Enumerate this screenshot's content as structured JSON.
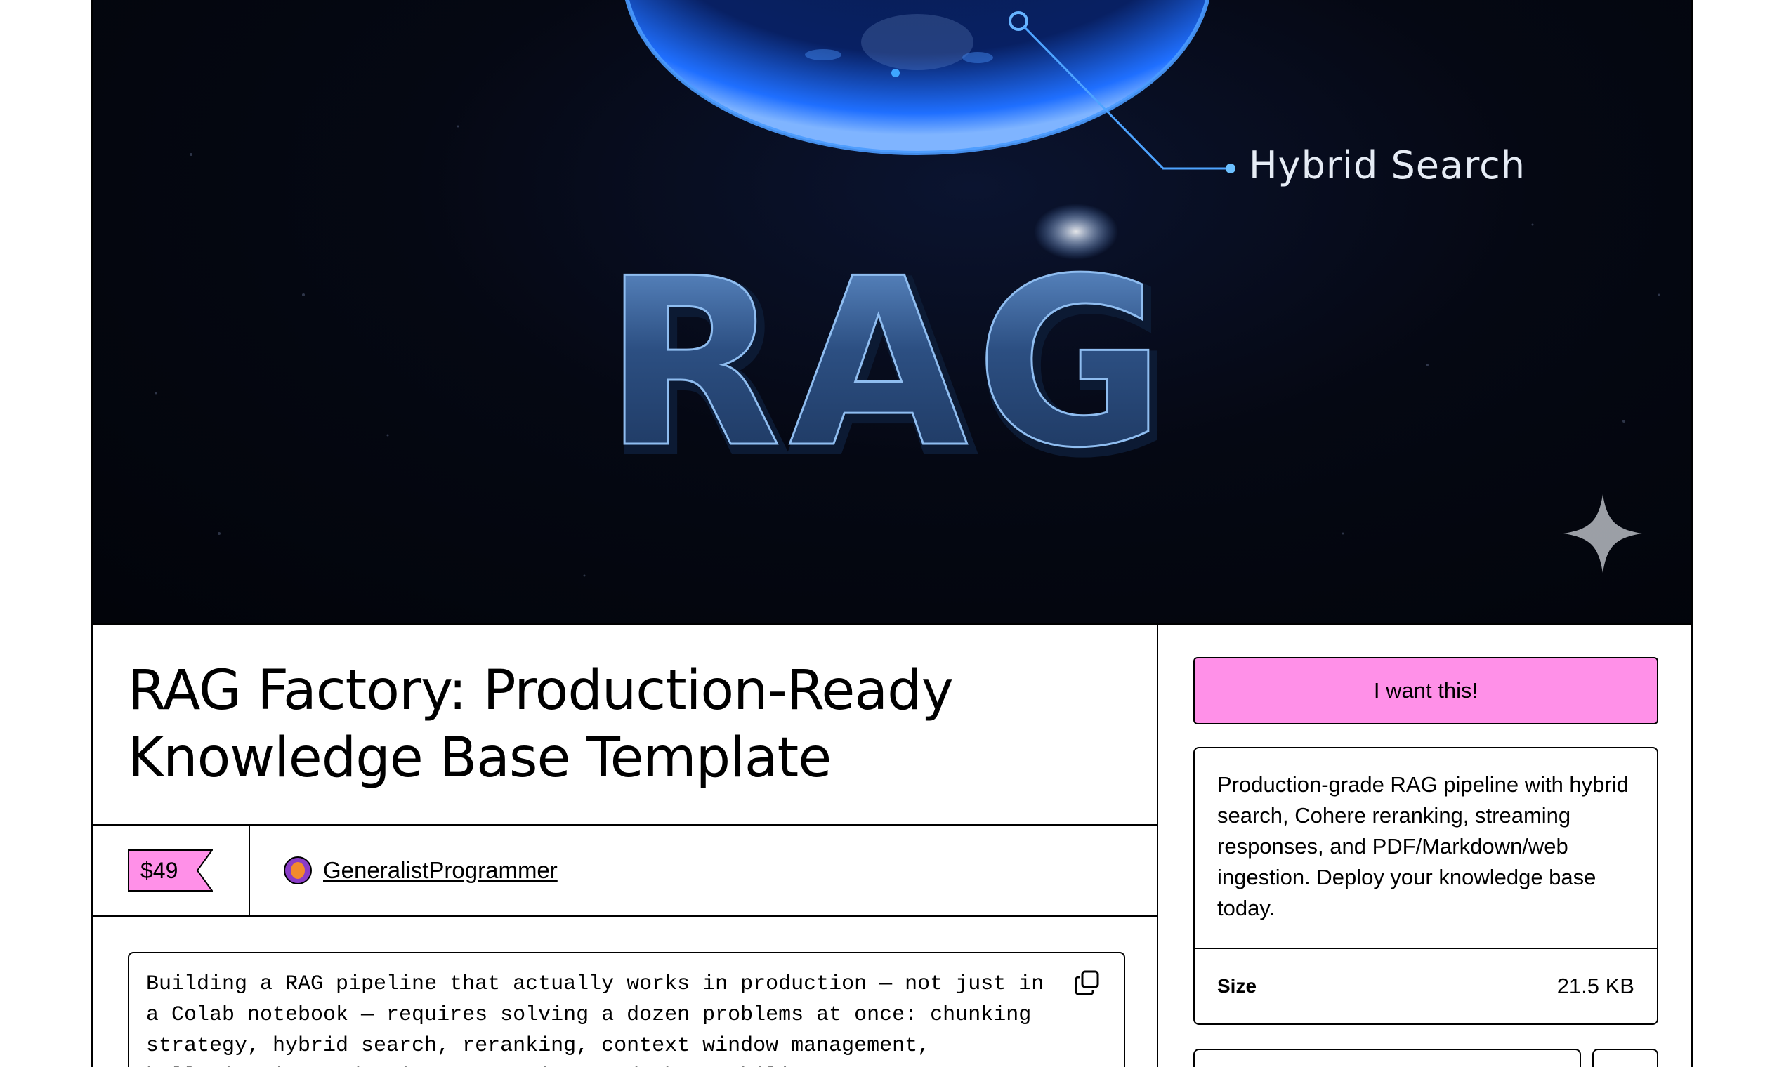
{
  "hero": {
    "callout_label": "Hybrid Search",
    "logo_text": "RAG",
    "colors": {
      "background": "#02040a",
      "globe_glow": "#2a7bff",
      "logo_steel": "#3d6fae"
    }
  },
  "product": {
    "title": "RAG Factory: Production-Ready Knowledge Base Template",
    "price": "$49",
    "creator": "GeneralistProgrammer",
    "description": "Building a RAG pipeline that actually works in production — not just in a Colab notebook — requires solving a dozen problems at once: chunking strategy, hybrid search, reranking, context window management, hallucination reduction, streaming, and observability. RAG Factory"
  },
  "sidebar": {
    "cta_label": "I want this!",
    "summary": "Production-grade RAG pipeline with hybrid search, Cohere reranking, streaming responses, and PDF/Markdown/web ingestion. Deploy your knowledge base today.",
    "size_label": "Size",
    "size_value": "21.5 KB"
  },
  "icons": {
    "copy": "copy-icon",
    "sparkle": "sparkle-icon"
  },
  "colors": {
    "accent_pink": "#ff90e8",
    "border": "#000000"
  }
}
